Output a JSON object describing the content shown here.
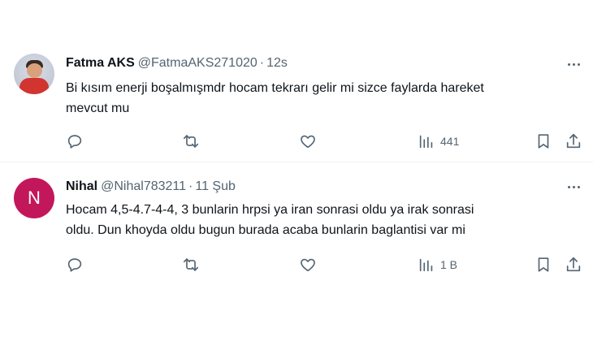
{
  "tweets": [
    {
      "avatar": {
        "type": "photo",
        "icon": "profile-photo-icon"
      },
      "name": "Fatma AKS",
      "handle": "@FatmaAKS271020",
      "separator": "·",
      "time": "12s",
      "text_lines": [
        "Bi kısım enerji boşalmışmdr hocam tekrarı gelir mi sizce faylarda hareket",
        "mevcut mu"
      ],
      "views": "441"
    },
    {
      "avatar": {
        "type": "letter",
        "letter": "N",
        "color": "#c2185b"
      },
      "name": "Nihal",
      "handle": "@Nihal783211",
      "separator": "·",
      "time": "11 Şub",
      "text_lines": [
        "Hocam 4,5-4.7-4-4, 3 bunlarin hrpsi ya iran sonrasi oldu ya irak sonrasi",
        "oldu. Dun khoyda oldu bugun burada acaba bunlarin baglantisi var mi"
      ],
      "views": "1 B"
    }
  ],
  "icons": [
    "more-icon",
    "reply-icon",
    "retweet-icon",
    "like-icon",
    "views-icon",
    "bookmark-icon",
    "share-icon"
  ],
  "colors": {
    "text": "#0f1419",
    "muted": "#536471",
    "divider": "#eff3f4",
    "avatar_letter_bg": "#c2185b"
  }
}
